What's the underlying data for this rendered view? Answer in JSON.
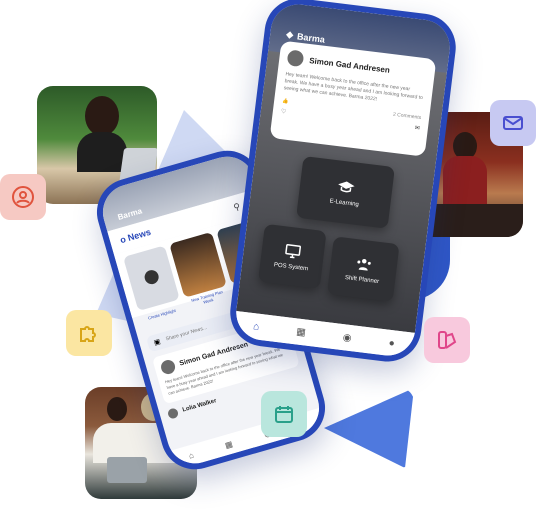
{
  "colors": {
    "phone_frame": "#2747b8",
    "accent_blue": "#2f57c7",
    "tile_red": "#f6c9c3",
    "tile_purple": "#c7c9f2",
    "tile_yellow": "#fbe6a2",
    "tile_pink": "#f8c9dd",
    "tile_teal": "#b9e6dd"
  },
  "icons": {
    "user": "user-circle-icon",
    "mail": "mail-icon",
    "puzzle": "puzzle-icon",
    "design": "palette-icon",
    "calendar": "calendar-icon"
  },
  "back_phone": {
    "brand": "Barma",
    "title": "o News",
    "cards": [
      {
        "label": "Create Highlight"
      },
      {
        "label": "New Training Plan Week"
      },
      {
        "label": ""
      }
    ],
    "share_placeholder": "Share your News...",
    "post": {
      "author": "Simon Gad Andresen",
      "body": "Hey team! Welcome back to the office after the new year break. We have a busy year ahead and I am looking forward to seeing what we can achieve. Barma 2022!"
    },
    "second_author": "Lolia Walker"
  },
  "front_phone": {
    "brand": "Barma",
    "post": {
      "author": "Simon Gad Andresen",
      "body": "Hey team! Welcome back to the office after the new year break. We have a busy year ahead and I am looking forward to seeing what we can achieve. Barma 2022!",
      "comments": "2 Comments"
    },
    "tiles": {
      "elearning": "E-Learning",
      "pos": "POS System",
      "shift": "Shift Planner"
    }
  }
}
